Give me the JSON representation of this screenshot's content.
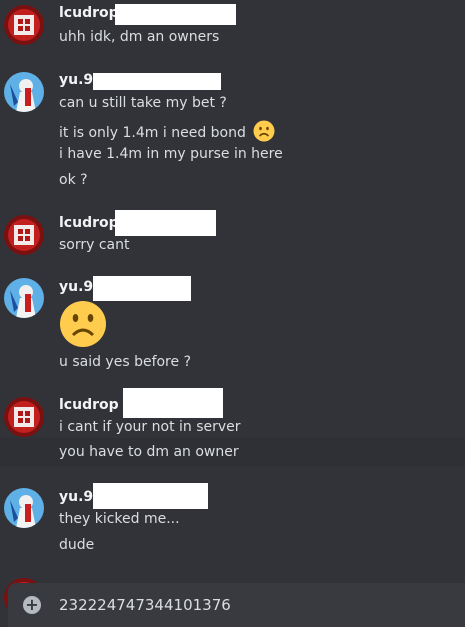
{
  "users": {
    "lcudrop": "lcudrop",
    "yu9": "yu.9"
  },
  "messages": [
    {
      "author": "lcudrop",
      "lines": [
        "uhh idk, dm an owners"
      ]
    },
    {
      "author": "yu.9",
      "lines": [
        "can u still take my bet ?",
        "it is only 1.4m i need bond",
        "i have 1.4m in my purse in here",
        "ok ?"
      ]
    },
    {
      "author": "lcudrop",
      "lines": [
        "sorry cant"
      ]
    },
    {
      "author": "yu.9",
      "lines": [
        "u said yes before ?"
      ]
    },
    {
      "author": "lcudrop",
      "lines": [
        "i cant if your not in server",
        "you have to dm an owner"
      ]
    },
    {
      "author": "yu.9",
      "lines": [
        "they kicked me...",
        "dude"
      ]
    }
  ],
  "emoji": {
    "inline": "frowning-face",
    "large": "frowning-face"
  },
  "composer": {
    "value": "232224747344101376"
  },
  "colors": {
    "background": "#313338",
    "composer": "#383a40",
    "redaction": "#ffffff"
  }
}
